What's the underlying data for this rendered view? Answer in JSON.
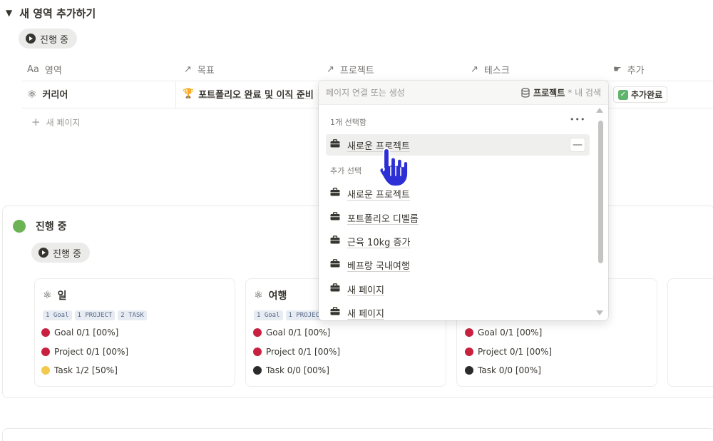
{
  "section": {
    "toggle": "▼",
    "title": "새 영역 추가하기",
    "view_label": "진행 중"
  },
  "table": {
    "headers": [
      {
        "icon": "Aa",
        "label": "영역"
      },
      {
        "icon": "↗",
        "label": "목표"
      },
      {
        "icon": "↗",
        "label": "프로젝트"
      },
      {
        "icon": "↗",
        "label": "테스크"
      },
      {
        "icon": "☛",
        "label": "추가"
      }
    ],
    "row": {
      "area": "커리어",
      "goal": "포트폴리오 완료 및 이직 준비",
      "added": "추가완료"
    },
    "new_page": "새 페이지"
  },
  "dropdown": {
    "placeholder": "페이지 연결 또는 생성",
    "scope_db": "프로젝트",
    "scope_suffix": "* 내 검색",
    "selected_label": "1개 선택함",
    "more": "•••",
    "selected_item": "새로운 프로젝트",
    "remove": "—",
    "add_label": "추가 선택",
    "options": [
      "새로운 프로젝트",
      "포트폴리오 디벨롭",
      "근육 10kg 증가",
      "베프랑 국내여행",
      "새 페이지",
      "새 페이지"
    ]
  },
  "board": {
    "title": "진행 중",
    "view_label": "진행 중",
    "cards": [
      {
        "title": "일",
        "tags": [
          "1 Goal",
          "1 PROJECT",
          "2 TASK"
        ],
        "goal": "Goal 0/1 [00%]",
        "project": "Project 0/1 [00%]",
        "task": "Task 1/2 [50%]"
      },
      {
        "title": "여행",
        "tags": [
          "1 Goal",
          "1 PROJECT"
        ],
        "goal": "Goal 0/1 [00%]",
        "project": "Project 0/1 [00%]",
        "task": "Task 0/0 [00%]"
      },
      {
        "title": "",
        "tags": [],
        "goal": "Goal 0/1 [00%]",
        "project": "Project 0/1 [00%]",
        "task": "Task 0/0 [00%]"
      }
    ]
  },
  "colors": {
    "goal_dot": "#c8203f",
    "project_dot": "#c8203f",
    "task_yellow": "#f2c94c",
    "task_black": "#2b2b2b",
    "status_green": "#6cb355",
    "done_check": "#5fb36b"
  }
}
